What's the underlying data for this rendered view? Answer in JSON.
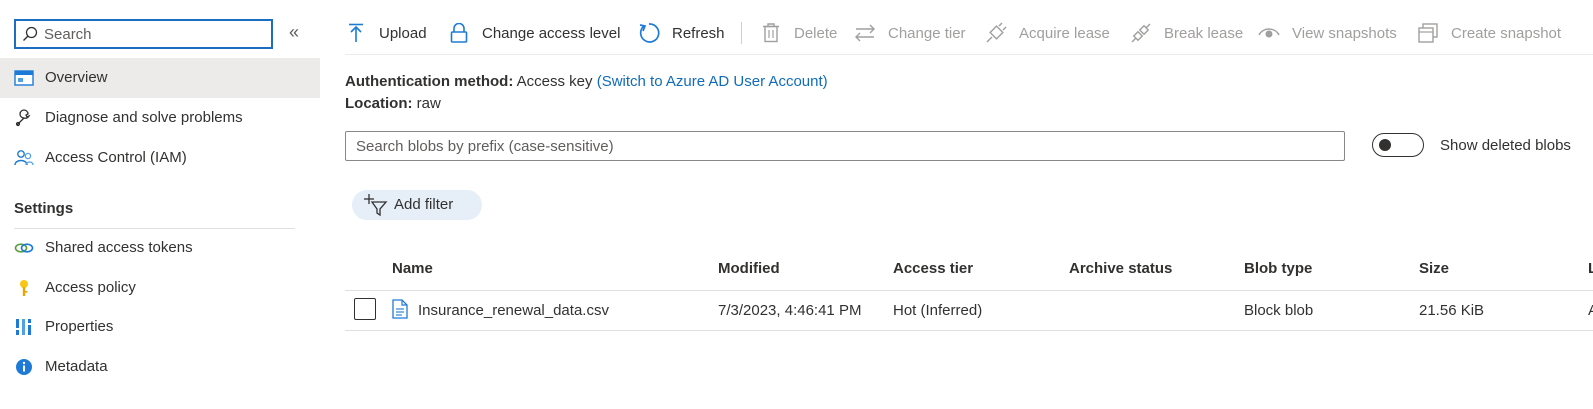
{
  "sidebar": {
    "search_placeholder": "Search",
    "collapse_glyph": "«",
    "items": [
      {
        "label": "Overview",
        "icon": "overview-icon"
      },
      {
        "label": "Diagnose and solve problems",
        "icon": "wrench-icon"
      },
      {
        "label": "Access Control (IAM)",
        "icon": "people-icon"
      }
    ],
    "settings_title": "Settings",
    "settings_items": [
      {
        "label": "Shared access tokens",
        "icon": "link-icon"
      },
      {
        "label": "Access policy",
        "icon": "key-icon"
      },
      {
        "label": "Properties",
        "icon": "properties-icon"
      },
      {
        "label": "Metadata",
        "icon": "info-icon"
      }
    ]
  },
  "toolbar": {
    "upload": "Upload",
    "change_access_level": "Change access level",
    "refresh": "Refresh",
    "delete": "Delete",
    "change_tier": "Change tier",
    "acquire_lease": "Acquire lease",
    "break_lease": "Break lease",
    "view_snapshots": "View snapshots",
    "create_snapshot": "Create snapshot"
  },
  "info": {
    "auth_label": "Authentication method:",
    "auth_value": "Access key",
    "auth_link": "(Switch to Azure AD User Account)",
    "location_label": "Location:",
    "location_value": "raw"
  },
  "blob_search": {
    "placeholder": "Search blobs by prefix (case-sensitive)",
    "toggle_label": "Show deleted blobs"
  },
  "add_filter": "Add filter",
  "table": {
    "columns": [
      "Name",
      "Modified",
      "Access tier",
      "Archive status",
      "Blob type",
      "Size",
      "L"
    ],
    "rows": [
      {
        "name": "Insurance_renewal_data.csv",
        "modified": "7/3/2023, 4:46:41 PM",
        "access_tier": "Hot (Inferred)",
        "archive_status": "",
        "blob_type": "Block blob",
        "size": "21.56 KiB",
        "last": "A"
      }
    ]
  },
  "colors": {
    "accent": "#0f6cbd",
    "selected_bg": "#edebe9",
    "filter_pill_bg": "#e6eef8",
    "disabled_text": "#a19f9d"
  }
}
